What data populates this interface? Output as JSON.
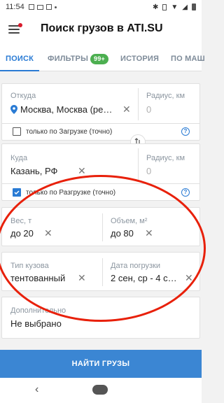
{
  "status_bar": {
    "time": "11:54"
  },
  "app_bar": {
    "title": "Поиск грузов в ATI.SU"
  },
  "tabs": [
    {
      "label": "ПОИСК"
    },
    {
      "label": "ФИЛЬТРЫ",
      "badge": "99+"
    },
    {
      "label": "ИСТОРИЯ"
    },
    {
      "label": "ПО МАШ"
    }
  ],
  "from": {
    "label": "Откуда",
    "value": "Москва, Москва (ре…",
    "radius_label": "Радиус, км",
    "radius_placeholder": "0",
    "checkbox_label": "только по Загрузке (точно)",
    "checked": false
  },
  "to": {
    "label": "Куда",
    "value": "Казань, РФ",
    "radius_label": "Радиус, км",
    "radius_placeholder": "0",
    "checkbox_label": "только по Разгрузке (точно)",
    "checked": true
  },
  "weight": {
    "label": "Вес, т",
    "value": "до 20"
  },
  "volume": {
    "label": "Объем, м²",
    "value": "до 80"
  },
  "body_type": {
    "label": "Тип кузова",
    "value": "тентованный"
  },
  "loading_date": {
    "label": "Дата погрузки",
    "value": "2 сен, ср - 4 с…"
  },
  "additional": {
    "label": "Дополнительно",
    "value": "Не выбрано"
  },
  "find_button": {
    "label": "НАЙТИ ГРУЗЫ"
  },
  "colors": {
    "accent": "#2a7bd4",
    "button": "#3b86d3",
    "badge": "#4caf50",
    "annotation": "#e8200a"
  }
}
